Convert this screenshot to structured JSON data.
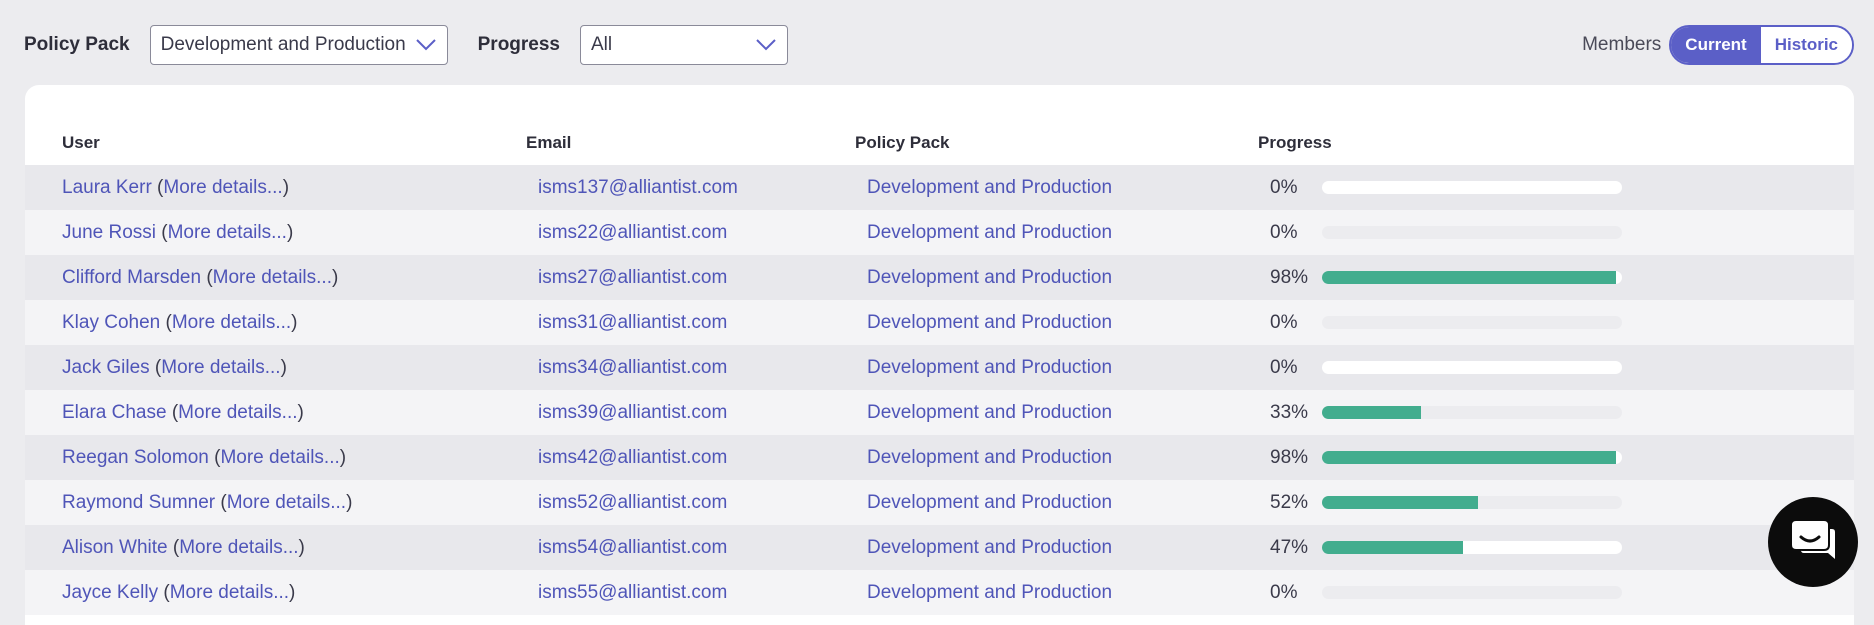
{
  "filters": {
    "policy_pack_label": "Policy Pack",
    "policy_pack_value": "Development and Production",
    "progress_label": "Progress",
    "progress_value": "All"
  },
  "members": {
    "label": "Members",
    "current": "Current",
    "historic": "Historic",
    "active": "Current"
  },
  "table": {
    "columns": [
      "User",
      "Email",
      "Policy Pack",
      "Progress"
    ],
    "rows": [
      {
        "user": "Laura Kerr",
        "details": "More details...",
        "email": "isms137@alliantist.com",
        "pack": "Development and Production",
        "progress": "0%",
        "value": 0,
        "track": "white"
      },
      {
        "user": "June Rossi",
        "details": "More details...",
        "email": "isms22@alliantist.com",
        "pack": "Development and Production",
        "progress": "0%",
        "value": 0,
        "track": "grey"
      },
      {
        "user": "Clifford Marsden",
        "details": "More details...",
        "email": "isms27@alliantist.com",
        "pack": "Development and Production",
        "progress": "98%",
        "value": 0.98,
        "track": "white"
      },
      {
        "user": "Klay Cohen",
        "details": "More details...",
        "email": "isms31@alliantist.com",
        "pack": "Development and Production",
        "progress": "0%",
        "value": 0,
        "track": "grey"
      },
      {
        "user": "Jack Giles",
        "details": "More details...",
        "email": "isms34@alliantist.com",
        "pack": "Development and Production",
        "progress": "0%",
        "value": 0,
        "track": "white"
      },
      {
        "user": "Elara Chase",
        "details": "More details...",
        "email": "isms39@alliantist.com",
        "pack": "Development and Production",
        "progress": "33%",
        "value": 0.33,
        "track": "grey"
      },
      {
        "user": "Reegan Solomon",
        "details": "More details...",
        "email": "isms42@alliantist.com",
        "pack": "Development and Production",
        "progress": "98%",
        "value": 0.98,
        "track": "white"
      },
      {
        "user": "Raymond Sumner",
        "details": "More details...",
        "email": "isms52@alliantist.com",
        "pack": "Development and Production",
        "progress": "52%",
        "value": 0.52,
        "track": "grey"
      },
      {
        "user": "Alison White",
        "details": "More details...",
        "email": "isms54@alliantist.com",
        "pack": "Development and Production",
        "progress": "47%",
        "value": 0.47,
        "track": "white"
      },
      {
        "user": "Jayce Kelly",
        "details": "More details...",
        "email": "isms55@alliantist.com",
        "pack": "Development and Production",
        "progress": "0%",
        "value": 0,
        "track": "grey"
      }
    ]
  },
  "chat": {
    "icon": "chat-icon"
  },
  "colors": {
    "accent": "#5b5fc7",
    "progress_fill": "#42ad8e",
    "link": "#4f55b8"
  }
}
